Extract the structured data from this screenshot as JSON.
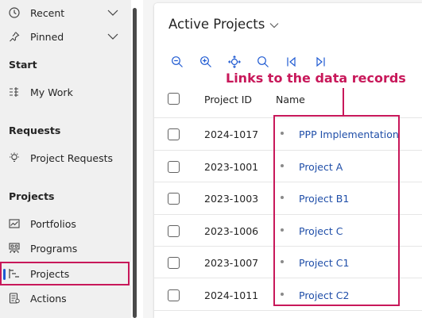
{
  "sidebar": {
    "recent_label": "Recent",
    "pinned_label": "Pinned",
    "start_section": "Start",
    "my_work_label": "My Work",
    "requests_section": "Requests",
    "project_requests_label": "Project Requests",
    "projects_section": "Projects",
    "portfolios_label": "Portfolios",
    "programs_label": "Programs",
    "projects_label": "Projects",
    "actions_label": "Actions"
  },
  "view": {
    "title": "Active Projects"
  },
  "annotation": {
    "text": "Links to the data records",
    "color": "#c8185a"
  },
  "table": {
    "columns": [
      "Project ID",
      "Name"
    ],
    "rows": [
      {
        "id": "2024-1017",
        "name": "PPP Implementation"
      },
      {
        "id": "2023-1001",
        "name": "Project A"
      },
      {
        "id": "2023-1003",
        "name": "Project B1"
      },
      {
        "id": "2023-1006",
        "name": "Project C"
      },
      {
        "id": "2023-1007",
        "name": "Project C1"
      },
      {
        "id": "2024-1011",
        "name": "Project C2"
      }
    ]
  },
  "colors": {
    "link": "#1f4ea8",
    "accent": "#1f5ad2",
    "highlight": "#c8185a"
  },
  "icons": [
    "clock-icon",
    "pin-icon",
    "my-work-icon",
    "lightbulb-icon",
    "portfolio-chart-icon",
    "programs-icon",
    "projects-icon",
    "actions-icon",
    "zoom-out-icon",
    "zoom-in-icon",
    "fit-to-view-icon",
    "search-icon",
    "go-first-icon",
    "go-last-icon"
  ]
}
